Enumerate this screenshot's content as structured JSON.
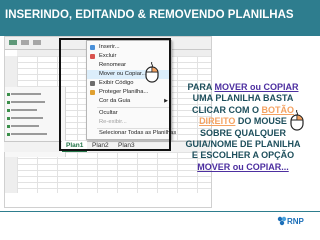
{
  "title": "INSERINDO, EDITANDO & REMOVENDO PLANILHAS",
  "menu": {
    "items": [
      {
        "label": "Inserir..."
      },
      {
        "label": "Excluir"
      },
      {
        "label": "Renomear"
      },
      {
        "label": "Mover ou Copiar...",
        "highlighted": true
      },
      {
        "label": "Exibir Código"
      },
      {
        "label": "Proteger Planilha..."
      },
      {
        "label": "Cor da Guia",
        "submenu": true
      },
      {
        "label": "Ocultar"
      },
      {
        "label": "Re-exibir...",
        "disabled": true
      },
      {
        "label": "Selecionar Todas as Planilhas"
      }
    ]
  },
  "sheet_tabs": [
    "Plan1",
    "Plan2",
    "Plan3"
  ],
  "active_tab": "Plan1",
  "instruction": {
    "part1": "PARA ",
    "mover": "MOVER ou COPIAR",
    "part2": " UMA PLANILHA BASTA CLICAR COM O ",
    "botao": "BOTÃO DIREITO",
    "part3": " DO MOUSE SOBRE QUALQUER GUIA/NOME DE PLANILHA E ESCOLHER A OPÇÃO ",
    "mover2": "MOVER ou COPIAR..."
  },
  "logo_text": "RNP",
  "colors": {
    "title_bar": "#2e7d8e",
    "instruction_text": "#1e4f5c",
    "highlight_blue": "#4d2fa0",
    "highlight_orange": "#f4a261",
    "excel_green": "#217346"
  }
}
